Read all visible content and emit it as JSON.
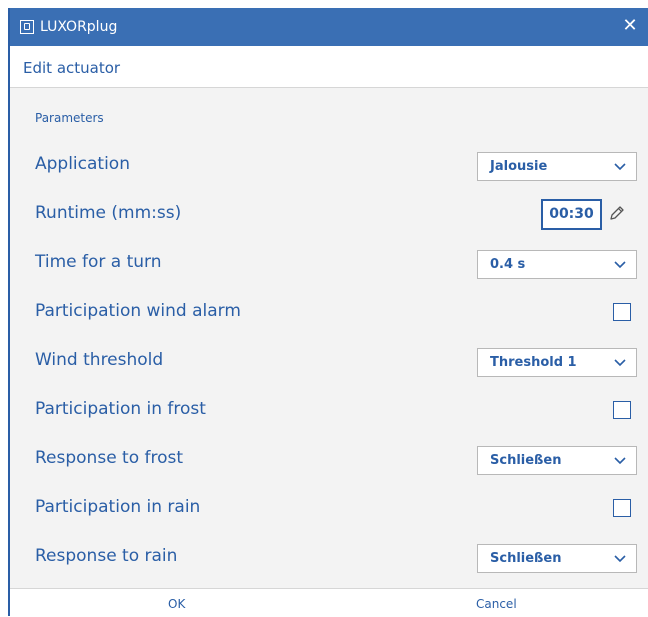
{
  "window": {
    "title": "LUXORplug",
    "close_glyph": "✕"
  },
  "header": {
    "title": "Edit actuator"
  },
  "section": {
    "label": "Parameters"
  },
  "params": {
    "application": {
      "label": "Application",
      "value": "Jalousie"
    },
    "runtime": {
      "label": "Runtime (mm:ss)",
      "value": "00:30"
    },
    "turn_time": {
      "label": "Time for a turn",
      "value": "0.4 s"
    },
    "wind_alarm": {
      "label": "Participation wind alarm",
      "checked": false
    },
    "wind_threshold": {
      "label": "Wind threshold",
      "value": "Threshold 1"
    },
    "frost": {
      "label": "Participation in frost",
      "checked": false
    },
    "frost_response": {
      "label": "Response to frost",
      "value": "Schließen"
    },
    "rain": {
      "label": "Participation in rain",
      "checked": false
    },
    "rain_response": {
      "label": "Response to rain",
      "value": "Schließen"
    }
  },
  "footer": {
    "ok_label": "OK",
    "cancel_label": "Cancel"
  },
  "colors": {
    "accent": "#2a5ea6",
    "titlebar": "#3a6fb4",
    "background": "#f3f3f3"
  },
  "icons": [
    "app-icon",
    "close-icon",
    "chevron-down-icon",
    "pencil-icon"
  ]
}
